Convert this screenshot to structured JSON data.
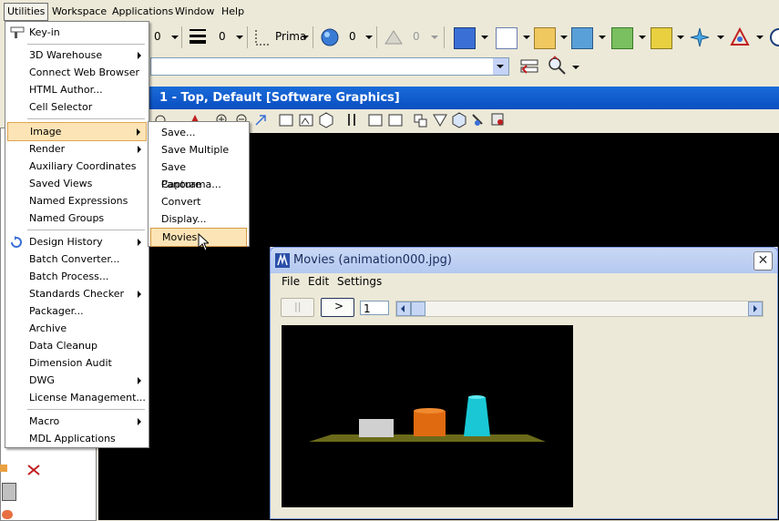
{
  "menubar": {
    "items": [
      "Utilities",
      "Workspace",
      "Applications",
      "Window",
      "Help"
    ]
  },
  "toolbar": {
    "level_value_1": "0",
    "weight_value": "0",
    "style_label": "Prima",
    "color_value": "0",
    "transparency_value": "0"
  },
  "view": {
    "title": "1 - Top, Default [Software Graphics]"
  },
  "utilities_menu": {
    "items": [
      "Key-in",
      "3D Warehouse",
      "Connect Web Browser",
      "HTML Author...",
      "Cell Selector",
      "Image",
      "Render",
      "Auxiliary Coordinates",
      "Saved Views",
      "Named Expressions",
      "Named Groups",
      "Design History",
      "Batch Converter...",
      "Batch Process...",
      "Standards Checker",
      "Packager...",
      "Archive",
      "Data Cleanup",
      "Dimension Audit",
      "DWG",
      "License Management...",
      "Macro",
      "MDL Applications"
    ]
  },
  "image_submenu": {
    "items": [
      "Save...",
      "Save Multiple",
      "Save Panorama...",
      "Capture",
      "Convert",
      "Display...",
      "Movies"
    ]
  },
  "movies_window": {
    "title": "Movies (animation000.jpg)",
    "menu": [
      "File",
      "Edit",
      "Settings"
    ],
    "pause_label": "||",
    "play_label": ">",
    "frame_value": "1",
    "close_label": "✕"
  },
  "colors": {
    "title_bar": "#0a4fc2",
    "menu_highlight": "#fce4b6",
    "ground": "#6b6a1a",
    "box": "#d0d0d0",
    "cylinder": "#e06a10",
    "cone": "#19c8d4"
  }
}
